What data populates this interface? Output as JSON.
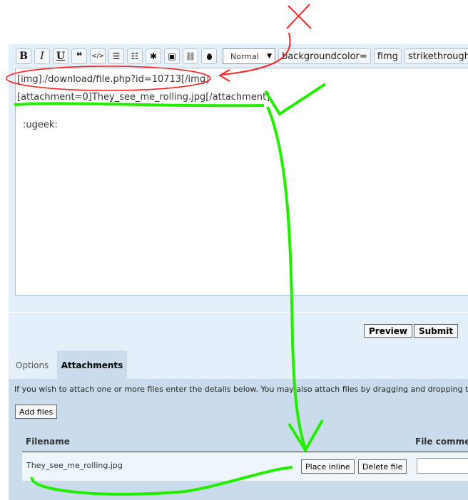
{
  "toolbar": {
    "buttons": [
      {
        "name": "bold",
        "glyph": "B"
      },
      {
        "name": "italic",
        "glyph": "I"
      },
      {
        "name": "underline",
        "glyph": "U"
      },
      {
        "name": "quote",
        "glyph": "❝"
      },
      {
        "name": "code",
        "glyph": "</>"
      },
      {
        "name": "list",
        "glyph": "☰"
      },
      {
        "name": "list-numbered",
        "glyph": "☷"
      },
      {
        "name": "list-item",
        "glyph": "✱"
      },
      {
        "name": "image",
        "glyph": "▣"
      },
      {
        "name": "link",
        "glyph": "⛓"
      },
      {
        "name": "color",
        "glyph": "💧"
      }
    ],
    "font_size_select": "Normal",
    "custom_buttons": [
      "backgroundcolor=",
      "fimg",
      "strikethrough"
    ]
  },
  "editor": {
    "lines": [
      "[img]./download/file.php?id=10713[/img]",
      "[attachment=0]They_see_me_rolling.jpg[/attachment]",
      "",
      ":ugeek:"
    ]
  },
  "actions": {
    "preview_label": "Preview",
    "submit_label": "Submit"
  },
  "tabs": [
    {
      "label": "Options",
      "active": false
    },
    {
      "label": "Attachments",
      "active": true
    }
  ],
  "attachments": {
    "help_text": "If you wish to attach one or more files enter the details below. You may also attach files by dragging and dropping them",
    "add_files_label": "Add files",
    "columns": [
      "Filename",
      "File comment"
    ],
    "rows": [
      {
        "filename": "They_see_me_rolling.jpg",
        "place_inline_label": "Place inline",
        "delete_label": "Delete file",
        "comment": ""
      }
    ]
  },
  "annotations": {
    "red_color": "#ff0000",
    "green_color": "#22ee00"
  }
}
